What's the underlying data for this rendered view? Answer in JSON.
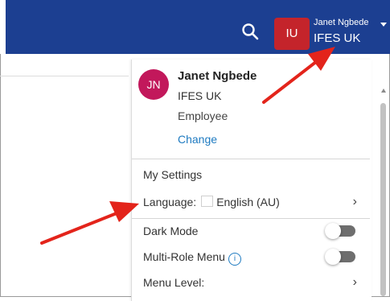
{
  "header": {
    "org_badge": "IU",
    "user_name": "Janet Ngbede",
    "user_org": "IFES UK"
  },
  "profile": {
    "initials": "JN",
    "name": "Janet Ngbede",
    "org": "IFES UK",
    "role": "Employee",
    "change_link": "Change"
  },
  "menu": {
    "my_settings": "My Settings",
    "language_label": "Language:",
    "language_value": "English (AU)",
    "dark_mode": "Dark Mode",
    "multi_role_menu": "Multi-Role Menu",
    "menu_level": "Menu Level:",
    "chevron": "›"
  },
  "colors": {
    "topbar": "#1c3f91",
    "org_badge": "#c4242b",
    "avatar": "#c2185b",
    "link": "#1f7bc1",
    "annotation_arrow": "#e3241b"
  },
  "icons": {
    "search": "search-icon",
    "dropdown": "caret-down-icon",
    "info": "info-icon"
  }
}
